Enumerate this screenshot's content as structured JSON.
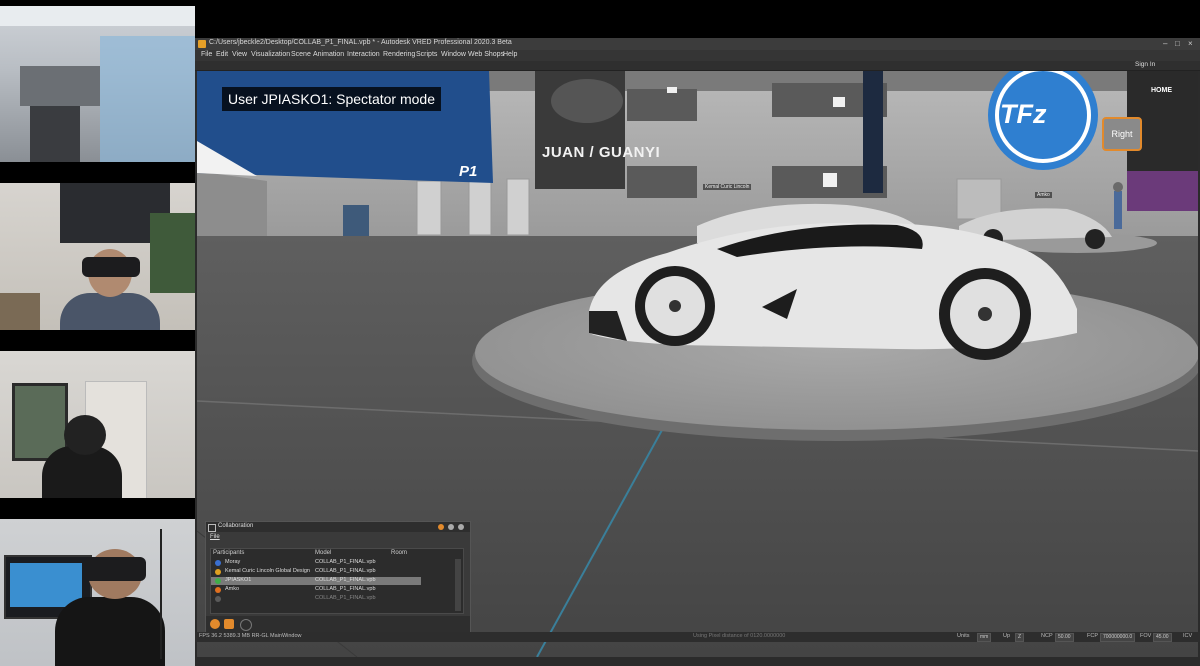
{
  "window": {
    "title": "C:/Users/jbeckle2/Desktop/COLLAB_P1_FINAL.vpb * - Autodesk VRED Professional 2020.3 Beta"
  },
  "menu": [
    "File",
    "Edit",
    "View",
    "Visualization",
    "Scene",
    "Animation",
    "Interaction",
    "Rendering",
    "Scripts",
    "Window",
    "Web Shops",
    "Help"
  ],
  "toolbar": {
    "sign_in": "Sign In"
  },
  "viewport": {
    "spectator_label": "User JPIASKO1: Spectator mode",
    "sign_text": "JUAN / GUANYI",
    "logo_text": "TFz",
    "badge_text": "P1",
    "nametags": [
      "Kemal Curic Lincoln",
      "Amko"
    ],
    "home_label": "HOME",
    "right_label": "Right"
  },
  "collaboration": {
    "title": "Collaboration",
    "file_menu": "File",
    "columns": [
      "Participants",
      "Model",
      "Room"
    ],
    "rows": [
      {
        "participant": "Moray",
        "model": "COLLAB_P1_FINAL.vpb",
        "icon_color": "#3a6fd0",
        "selected": false
      },
      {
        "participant": "Kemal Curic Lincoln Global Design",
        "model": "COLLAB_P1_FINAL.vpb",
        "icon_color": "#e0a020",
        "selected": false
      },
      {
        "participant": "JPIASKO1",
        "model": "COLLAB_P1_FINAL.vpb",
        "icon_color": "#3fae49",
        "selected": true
      },
      {
        "participant": "Amko",
        "model": "COLLAB_P1_FINAL.vpb",
        "icon_color": "#e07020",
        "selected": false
      },
      {
        "participant": "",
        "model": "COLLAB_P1_FINAL.vpb",
        "icon_color": "#888888",
        "selected": false
      }
    ]
  },
  "statusbar": {
    "left": "FPS 36.2  5389.3 MB  RR-GL  MainWindow",
    "message": "Using Pixel distance of 0120.0000000",
    "units_label": "Units",
    "units_value": "mm",
    "up_label": "Up",
    "up_value": "Z",
    "ncp_label": "NCP",
    "ncp_value": "50.00",
    "fcp_label": "FCP",
    "fcp_value": "700000000.0",
    "fov_label": "FOV",
    "fov_value": "45.00",
    "ict": "ICV"
  },
  "colors": {
    "accent": "#e28a2c",
    "panel_bg": "#3a3a3a",
    "selection": "#7a7a7a"
  }
}
